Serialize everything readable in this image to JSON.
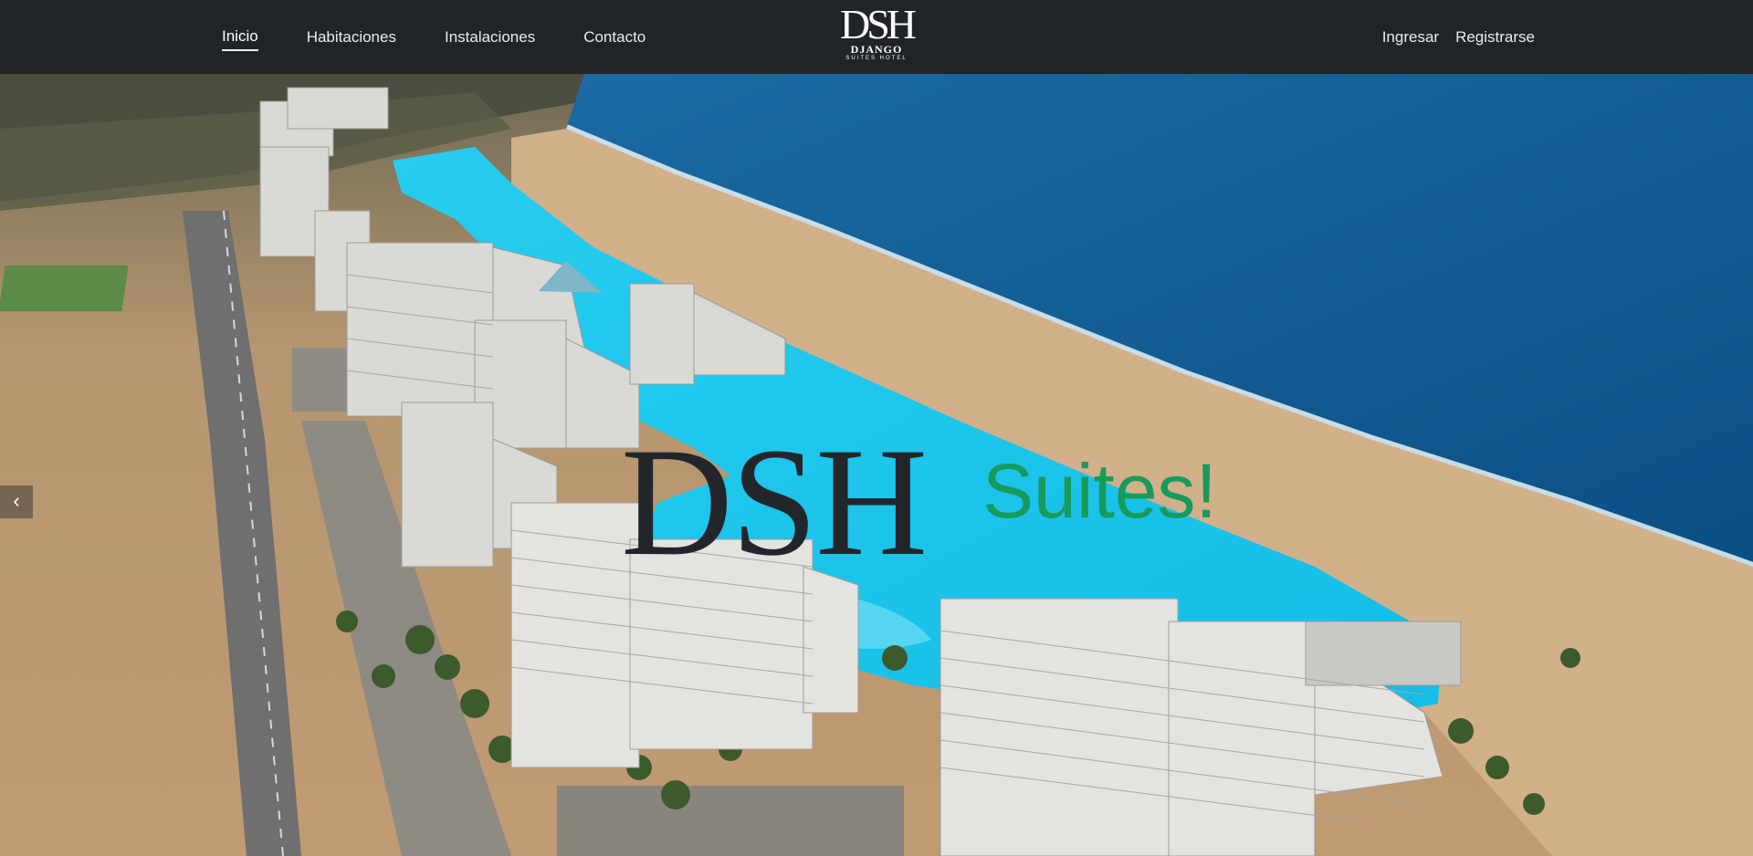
{
  "nav": {
    "left_items": [
      {
        "label": "Inicio",
        "active": true
      },
      {
        "label": "Habitaciones"
      },
      {
        "label": "Instalaciones"
      },
      {
        "label": "Contacto"
      }
    ],
    "right_items": [
      {
        "label": "Ingresar"
      },
      {
        "label": "Registrarse"
      }
    ]
  },
  "brand": {
    "mark": "DSH",
    "line1": "DJANGO",
    "line2": "SUITES HOTEL"
  },
  "hero": {
    "title": "DSH",
    "subtitle": "Suites!",
    "prev_icon": "chevron-left-icon"
  },
  "colors": {
    "navbar_bg": "#202328",
    "title": "#22262b",
    "subtitle": "#189a5d",
    "lagoon": "#1ec8ec",
    "ocean": "#0f5e96",
    "sand": "#c9a47a"
  }
}
